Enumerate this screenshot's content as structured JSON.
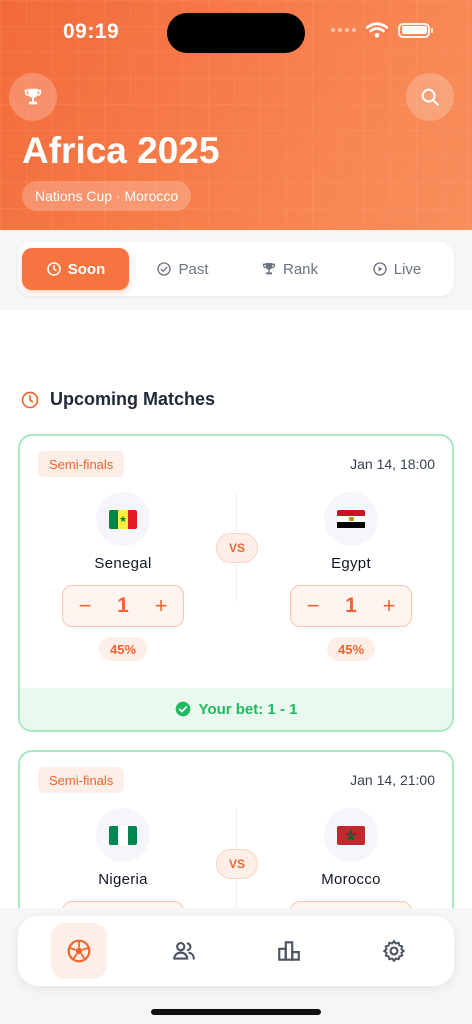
{
  "status_bar": {
    "time": "09:19"
  },
  "header": {
    "title": "Africa 2025",
    "subtitle": "Nations Cup · Morocco",
    "left_icon": "trophy-icon",
    "right_icon": "search-icon"
  },
  "tabs": [
    {
      "label": "Soon",
      "icon": "clock-icon",
      "active": true
    },
    {
      "label": "Past",
      "icon": "check-circle-icon",
      "active": false
    },
    {
      "label": "Rank",
      "icon": "trophy-icon",
      "active": false
    },
    {
      "label": "Live",
      "icon": "play-circle-icon",
      "active": false
    }
  ],
  "section": {
    "title": "Upcoming Matches",
    "icon": "clock-icon"
  },
  "matches": [
    {
      "stage": "Semi-finals",
      "time": "Jan 14, 18:00",
      "vs_label": "VS",
      "home": {
        "name": "Senegal",
        "score": "1",
        "percent": "45%",
        "flag": "senegal-flag"
      },
      "away": {
        "name": "Egypt",
        "score": "1",
        "percent": "45%",
        "flag": "egypt-flag"
      },
      "bet": "Your bet: 1 - 1"
    },
    {
      "stage": "Semi-finals",
      "time": "Jan 14, 21:00",
      "vs_label": "VS",
      "home": {
        "name": "Nigeria",
        "flag": "nigeria-flag"
      },
      "away": {
        "name": "Morocco",
        "flag": "morocco-flag"
      }
    }
  ],
  "stepper": {
    "minus": "−",
    "plus": "+"
  },
  "bottom_nav": [
    {
      "icon": "soccer-ball-icon",
      "active": true
    },
    {
      "icon": "users-icon",
      "active": false
    },
    {
      "icon": "podium-icon",
      "active": false
    },
    {
      "icon": "settings-gear-icon",
      "active": false
    }
  ],
  "colors": {
    "accent": "#f6743f",
    "success": "#22b861",
    "card_border": "#a7e8bf"
  }
}
